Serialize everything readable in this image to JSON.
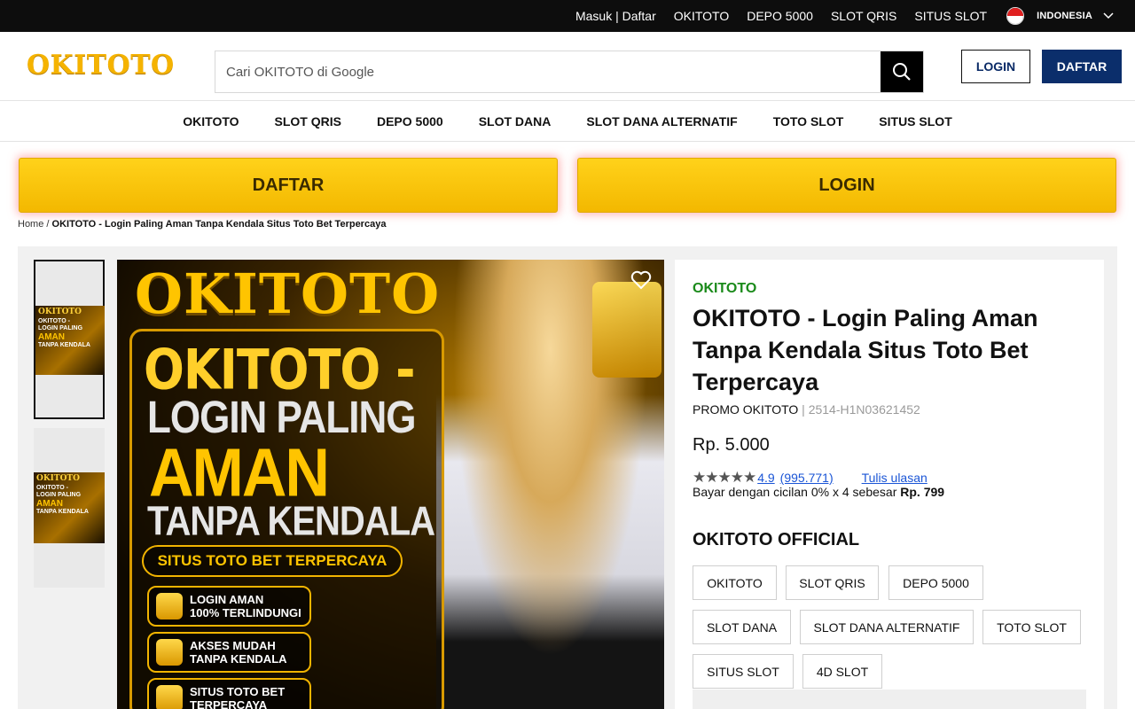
{
  "topbar": {
    "auth": "Masuk | Daftar",
    "links": [
      "OKITOTO",
      "DEPO 5000",
      "SLOT QRIS",
      "SITUS SLOT"
    ],
    "language": "INDONESIA"
  },
  "header": {
    "logo": "OKITOTO",
    "search_placeholder": "Cari OKITOTO di Google",
    "login_label": "LOGIN",
    "daftar_label": "DAFTAR"
  },
  "nav": [
    "OKITOTO",
    "SLOT QRIS",
    "DEPO 5000",
    "SLOT DANA",
    "SLOT DANA ALTERNATIF",
    "TOTO SLOT",
    "SITUS SLOT"
  ],
  "cta": {
    "left": "DAFTAR",
    "right": "LOGIN"
  },
  "breadcrumb": {
    "home": "Home",
    "separator": "/",
    "current": "OKITOTO - Login Paling Aman Tanpa Kendala Situs Toto Bet Terpercaya"
  },
  "thumbs": {
    "mini_title": "OKITOTO",
    "mini_lines": [
      "OKITOTO -",
      "LOGIN PALING",
      "AMAN",
      "TANPA KENDALA"
    ]
  },
  "hero": {
    "brand": "OKITOTO",
    "line1": "OKITOTO -",
    "line2": "LOGIN PALING",
    "line3": "AMAN",
    "line4": "TANPA KENDALA",
    "pill": "SITUS TOTO BET TERPERCAYA",
    "features": [
      {
        "icon": "shield-icon",
        "text": "LOGIN AMAN\n100% TERLINDUNGI"
      },
      {
        "icon": "lightning-icon",
        "text": "AKSES MUDAH\nTANPA KENDALA"
      },
      {
        "icon": "trophy-icon",
        "text": "SITUS TOTO BET\nTERPERCAYA"
      }
    ]
  },
  "product": {
    "brand": "OKITOTO",
    "title": "OKITOTO - Login Paling Aman Tanpa Kendala Situs Toto Bet Terpercaya",
    "seller": "PROMO OKITOTO",
    "sku_separator": "|",
    "sku": "2514-H1N03621452",
    "price": "Rp. 5.000",
    "stars": "★★★★★",
    "rating": "4.9",
    "reviews": "(995.771)",
    "write_review": "Tulis ulasan",
    "installment_text": "Bayar dengan cicilan 0% x 4 sebesar",
    "installment_amount": "Rp. 799",
    "official_heading": "OKITOTO OFFICIAL",
    "tags": [
      "OKITOTO",
      "SLOT QRIS",
      "DEPO 5000",
      "SLOT DANA",
      "SLOT DANA ALTERNATIF",
      "TOTO SLOT",
      "SITUS SLOT",
      "4D SLOT"
    ]
  },
  "colors": {
    "accent_yellow": "#f5b300",
    "nav_blue": "#0b2e6b",
    "brand_green": "#1a8a1a",
    "link_blue": "#1a55d6"
  }
}
